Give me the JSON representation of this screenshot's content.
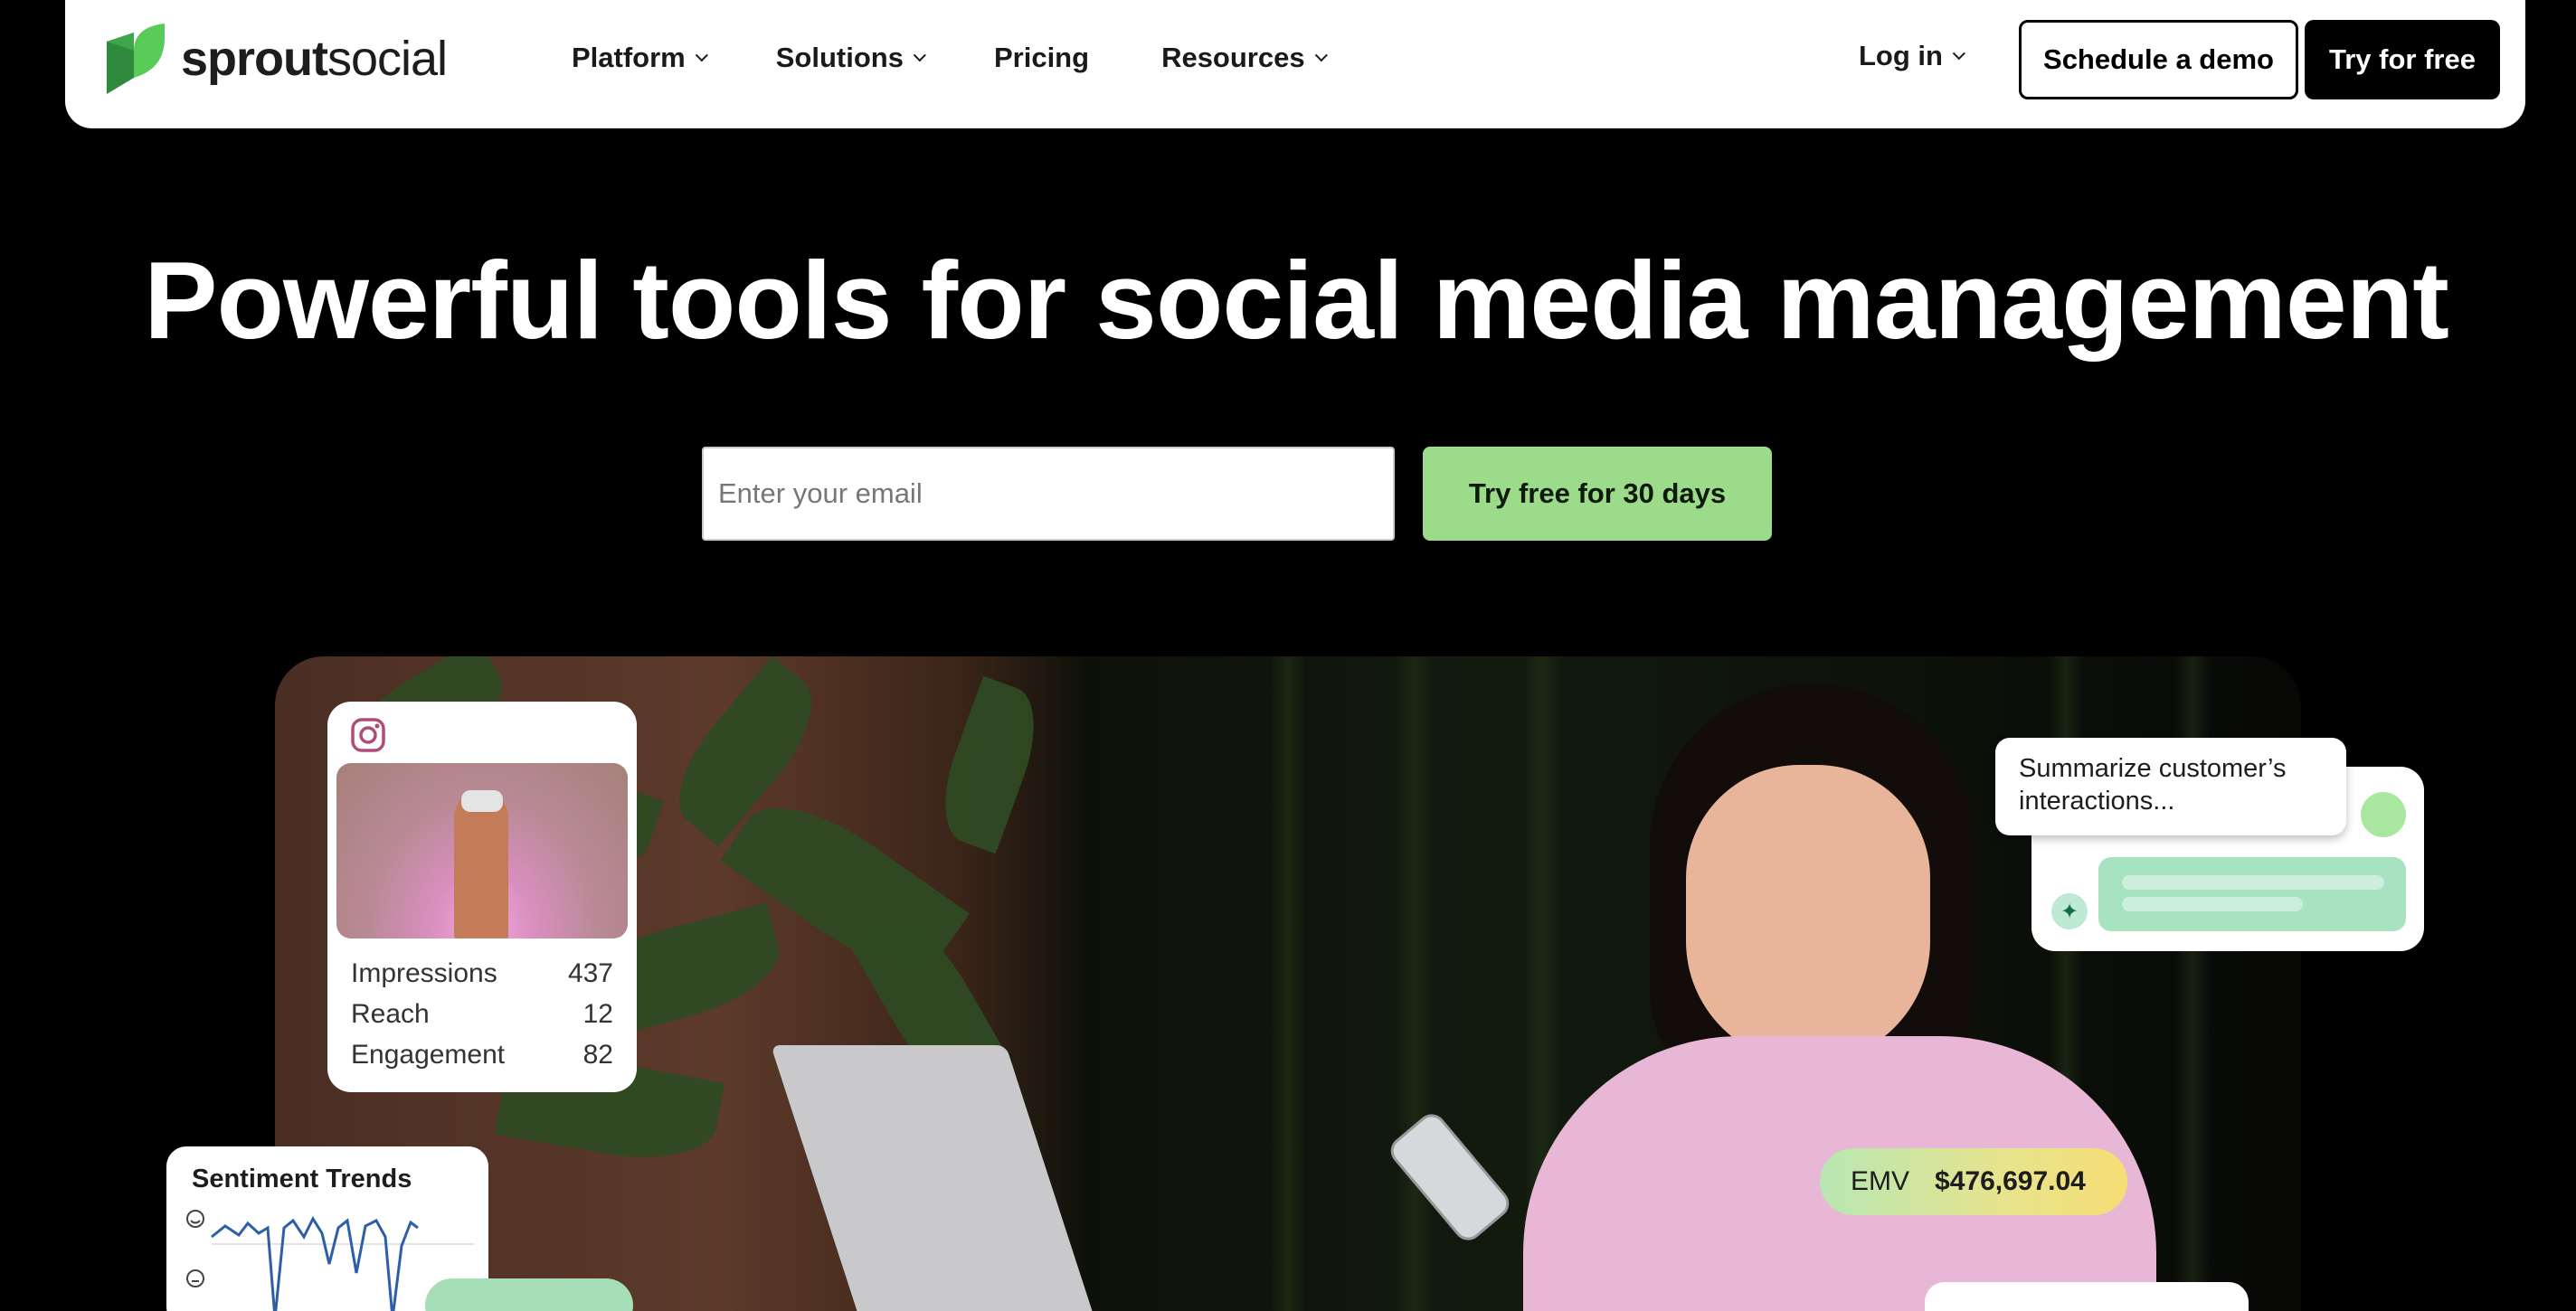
{
  "brand": {
    "name_bold": "sprout",
    "name_light": "social",
    "accent": "#59cb59"
  },
  "nav": {
    "items": [
      {
        "label": "Platform",
        "has_dropdown": true
      },
      {
        "label": "Solutions",
        "has_dropdown": true
      },
      {
        "label": "Pricing",
        "has_dropdown": false
      },
      {
        "label": "Resources",
        "has_dropdown": true
      }
    ],
    "login_label": "Log in",
    "demo_label": "Schedule a demo",
    "try_label": "Try for free"
  },
  "hero": {
    "title": "Powerful tools for social media management",
    "email_placeholder": "Enter your email",
    "cta_label": "Try free for 30 days",
    "cta_color": "#9bdb8a"
  },
  "instagram_card": {
    "icon": "instagram-icon",
    "stats": [
      {
        "label": "Impressions",
        "value": "437"
      },
      {
        "label": "Reach",
        "value": "12"
      },
      {
        "label": "Engagement",
        "value": "82"
      }
    ]
  },
  "sentiment_card": {
    "title": "Sentiment Trends"
  },
  "ai_card": {
    "prompt": "Summarize customer’s interactions..."
  },
  "emv_pill": {
    "label": "EMV",
    "value": "$476,697.04"
  }
}
